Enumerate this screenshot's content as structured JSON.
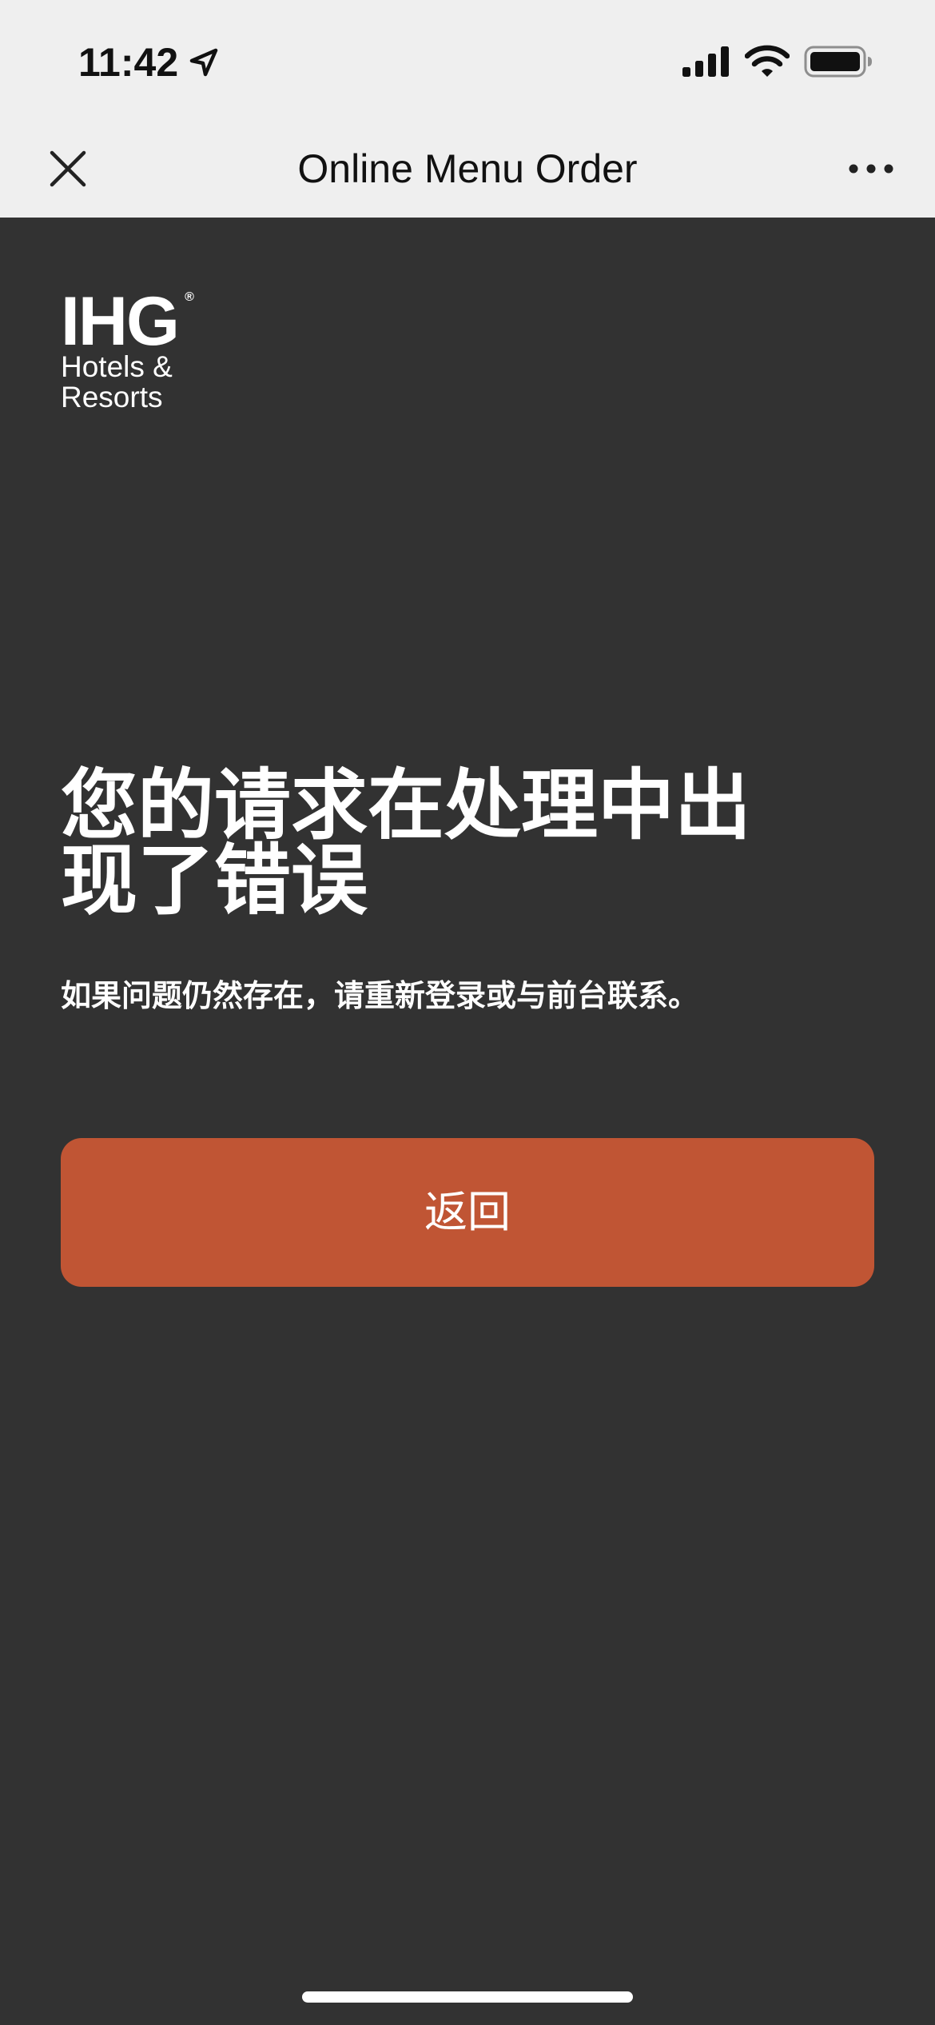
{
  "status_bar": {
    "time": "11:42",
    "icons": {
      "location": "location-arrow-icon",
      "signal": "cellular-signal-icon",
      "wifi": "wifi-icon",
      "battery": "battery-icon"
    }
  },
  "nav_bar": {
    "title": "Online Menu Order",
    "close_icon": "close-icon",
    "more_icon": "more-icon"
  },
  "logo": {
    "mark": "IHG",
    "registered": "®",
    "line1": "Hotels &",
    "line2": "Resorts"
  },
  "error": {
    "title": "您的请求在处理中出现了错误",
    "message": "如果问题仍然存在，请重新登录或与前台联系。"
  },
  "actions": {
    "back_label": "返回"
  },
  "colors": {
    "chrome_background": "#efefef",
    "page_background": "#323232",
    "button_accent": "#c05534",
    "text_light": "#ffffff",
    "text_dark": "#111111"
  }
}
